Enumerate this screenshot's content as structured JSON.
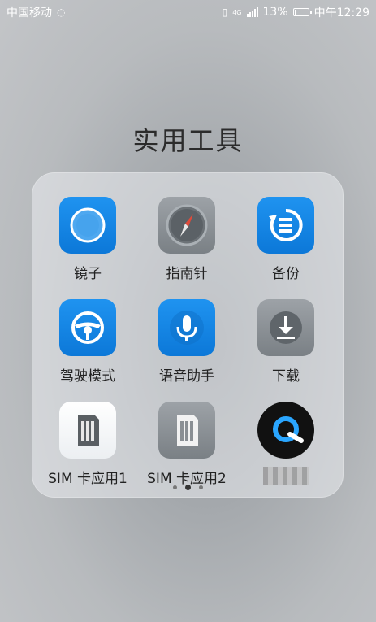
{
  "statusbar": {
    "carrier": "中国移动",
    "network": "4G",
    "battery_percent": "13%",
    "battery_level": 0.13,
    "time": "中午12:29"
  },
  "folder": {
    "title": "实用工具",
    "apps": [
      {
        "label": "镜子",
        "icon": "mirror-icon"
      },
      {
        "label": "指南针",
        "icon": "compass-icon"
      },
      {
        "label": "备份",
        "icon": "backup-icon"
      },
      {
        "label": "驾驶模式",
        "icon": "steering-wheel-icon"
      },
      {
        "label": "语音助手",
        "icon": "microphone-icon"
      },
      {
        "label": "下载",
        "icon": "download-icon"
      },
      {
        "label": "SIM 卡应用1",
        "icon": "sim-card-icon"
      },
      {
        "label": "SIM 卡应用2",
        "icon": "sim-card-icon"
      },
      {
        "label": "",
        "icon": "app-logo-icon"
      }
    ],
    "pages": 3,
    "active_page": 2
  },
  "colors": {
    "accent_blue": "#1587e6",
    "gray_icon": "#8a8f94"
  }
}
